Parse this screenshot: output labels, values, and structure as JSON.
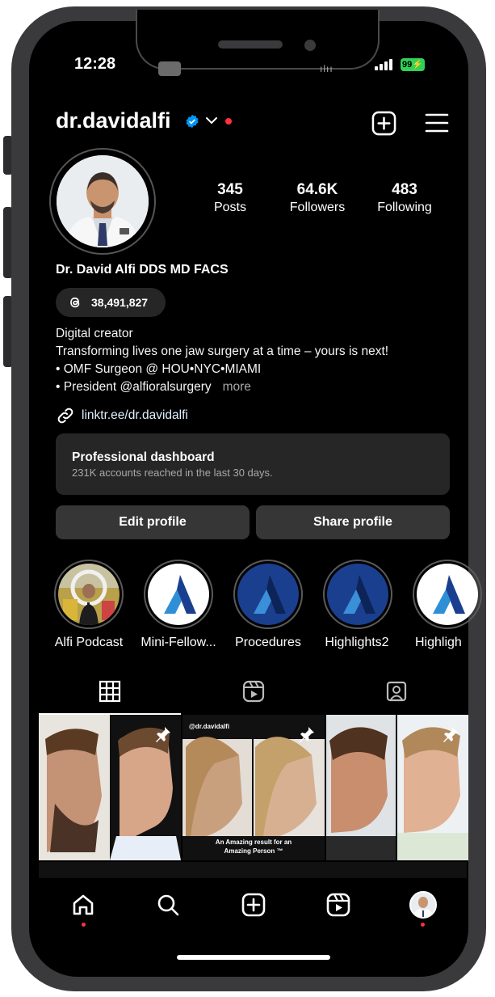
{
  "status": {
    "time": "12:28",
    "battery": "99"
  },
  "profile": {
    "username": "dr.davidalfi",
    "full_name": "Dr. David Alfi DDS MD FACS",
    "threads_count": "38,491,827",
    "stats": [
      {
        "value": "345",
        "label": "Posts"
      },
      {
        "value": "64.6K",
        "label": "Followers"
      },
      {
        "value": "483",
        "label": "Following"
      }
    ],
    "bio": {
      "category": "Digital creator",
      "lines": [
        "Transforming lives one jaw surgery at a time – yours is next!",
        "• OMF Surgeon @ HOU•NYC•MIAMI",
        "• President @alfioralsurgery"
      ],
      "more": "more"
    },
    "link": "linktr.ee/dr.davidalfi"
  },
  "dashboard": {
    "title": "Professional dashboard",
    "subtitle": "231K accounts reached in the last 30 days."
  },
  "buttons": {
    "edit": "Edit profile",
    "share": "Share profile"
  },
  "highlights": [
    {
      "label": "Alfi Podcast",
      "icon": "podcast-photo"
    },
    {
      "label": "Mini-Fellow...",
      "icon": "alfi-logo"
    },
    {
      "label": "Procedures",
      "icon": "alfi-logo"
    },
    {
      "label": "Highlights2",
      "icon": "alfi-logo"
    },
    {
      "label": "Highligh",
      "icon": "alfi-logo"
    }
  ],
  "tabs": [
    "grid-icon",
    "reels-icon",
    "tagged-icon"
  ],
  "posts": [
    {
      "caption_top": "",
      "caption_bottom": ""
    },
    {
      "caption_top": "@dr.davidalfi",
      "caption_bottom": "An Amazing result for an Amazing Person ™"
    },
    {
      "caption_top": "",
      "caption_bottom": ""
    }
  ],
  "colors": {
    "accent_blue": "#0095f6",
    "notification_red": "#ff3040",
    "battery_green": "#30d158"
  }
}
